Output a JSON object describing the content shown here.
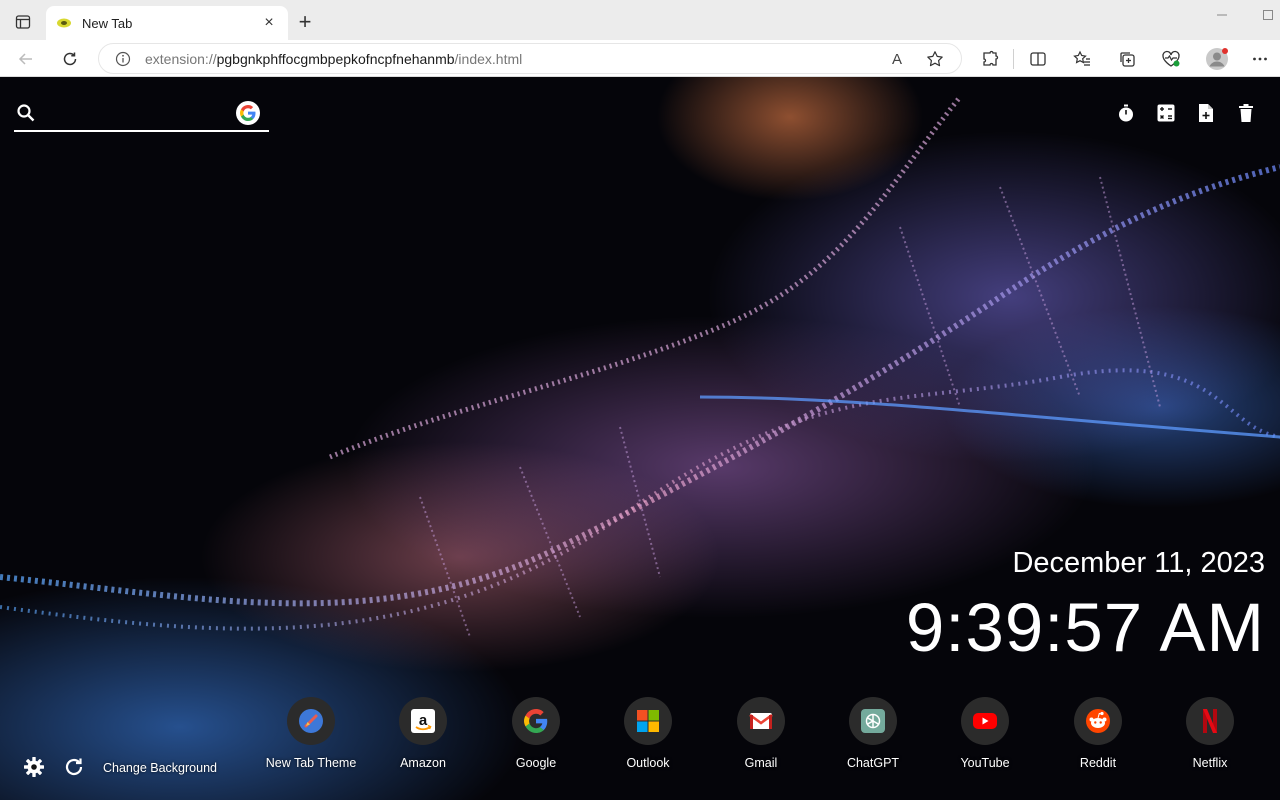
{
  "browser": {
    "tab": {
      "title": "New Tab",
      "close_glyph": "×"
    },
    "new_tab_glyph": "+",
    "url_scheme": "extension://",
    "url_host": "pgbgnkphffocgmbpepkofncpfnehanmb",
    "url_path": "/index.html",
    "read_aloud_glyph": "A"
  },
  "search": {
    "value": "",
    "placeholder": ""
  },
  "clock": {
    "date": "December 11, 2023",
    "time": "9:39:57 AM"
  },
  "shortcuts": [
    {
      "label": "New Tab Theme",
      "icon": "new-tab-theme-icon"
    },
    {
      "label": "Amazon",
      "icon": "amazon-icon"
    },
    {
      "label": "Google",
      "icon": "google-icon"
    },
    {
      "label": "Outlook",
      "icon": "outlook-icon"
    },
    {
      "label": "Gmail",
      "icon": "gmail-icon"
    },
    {
      "label": "ChatGPT",
      "icon": "chatgpt-icon"
    },
    {
      "label": "YouTube",
      "icon": "youtube-icon"
    },
    {
      "label": "Reddit",
      "icon": "reddit-icon"
    },
    {
      "label": "Netflix",
      "icon": "netflix-icon"
    }
  ],
  "footer": {
    "change_background_label": "Change Background"
  },
  "colors": {
    "accent_google_blue": "#4285F4",
    "youtube_red": "#FF0000",
    "netflix_red": "#E50914",
    "reddit_orange": "#FF4500"
  }
}
